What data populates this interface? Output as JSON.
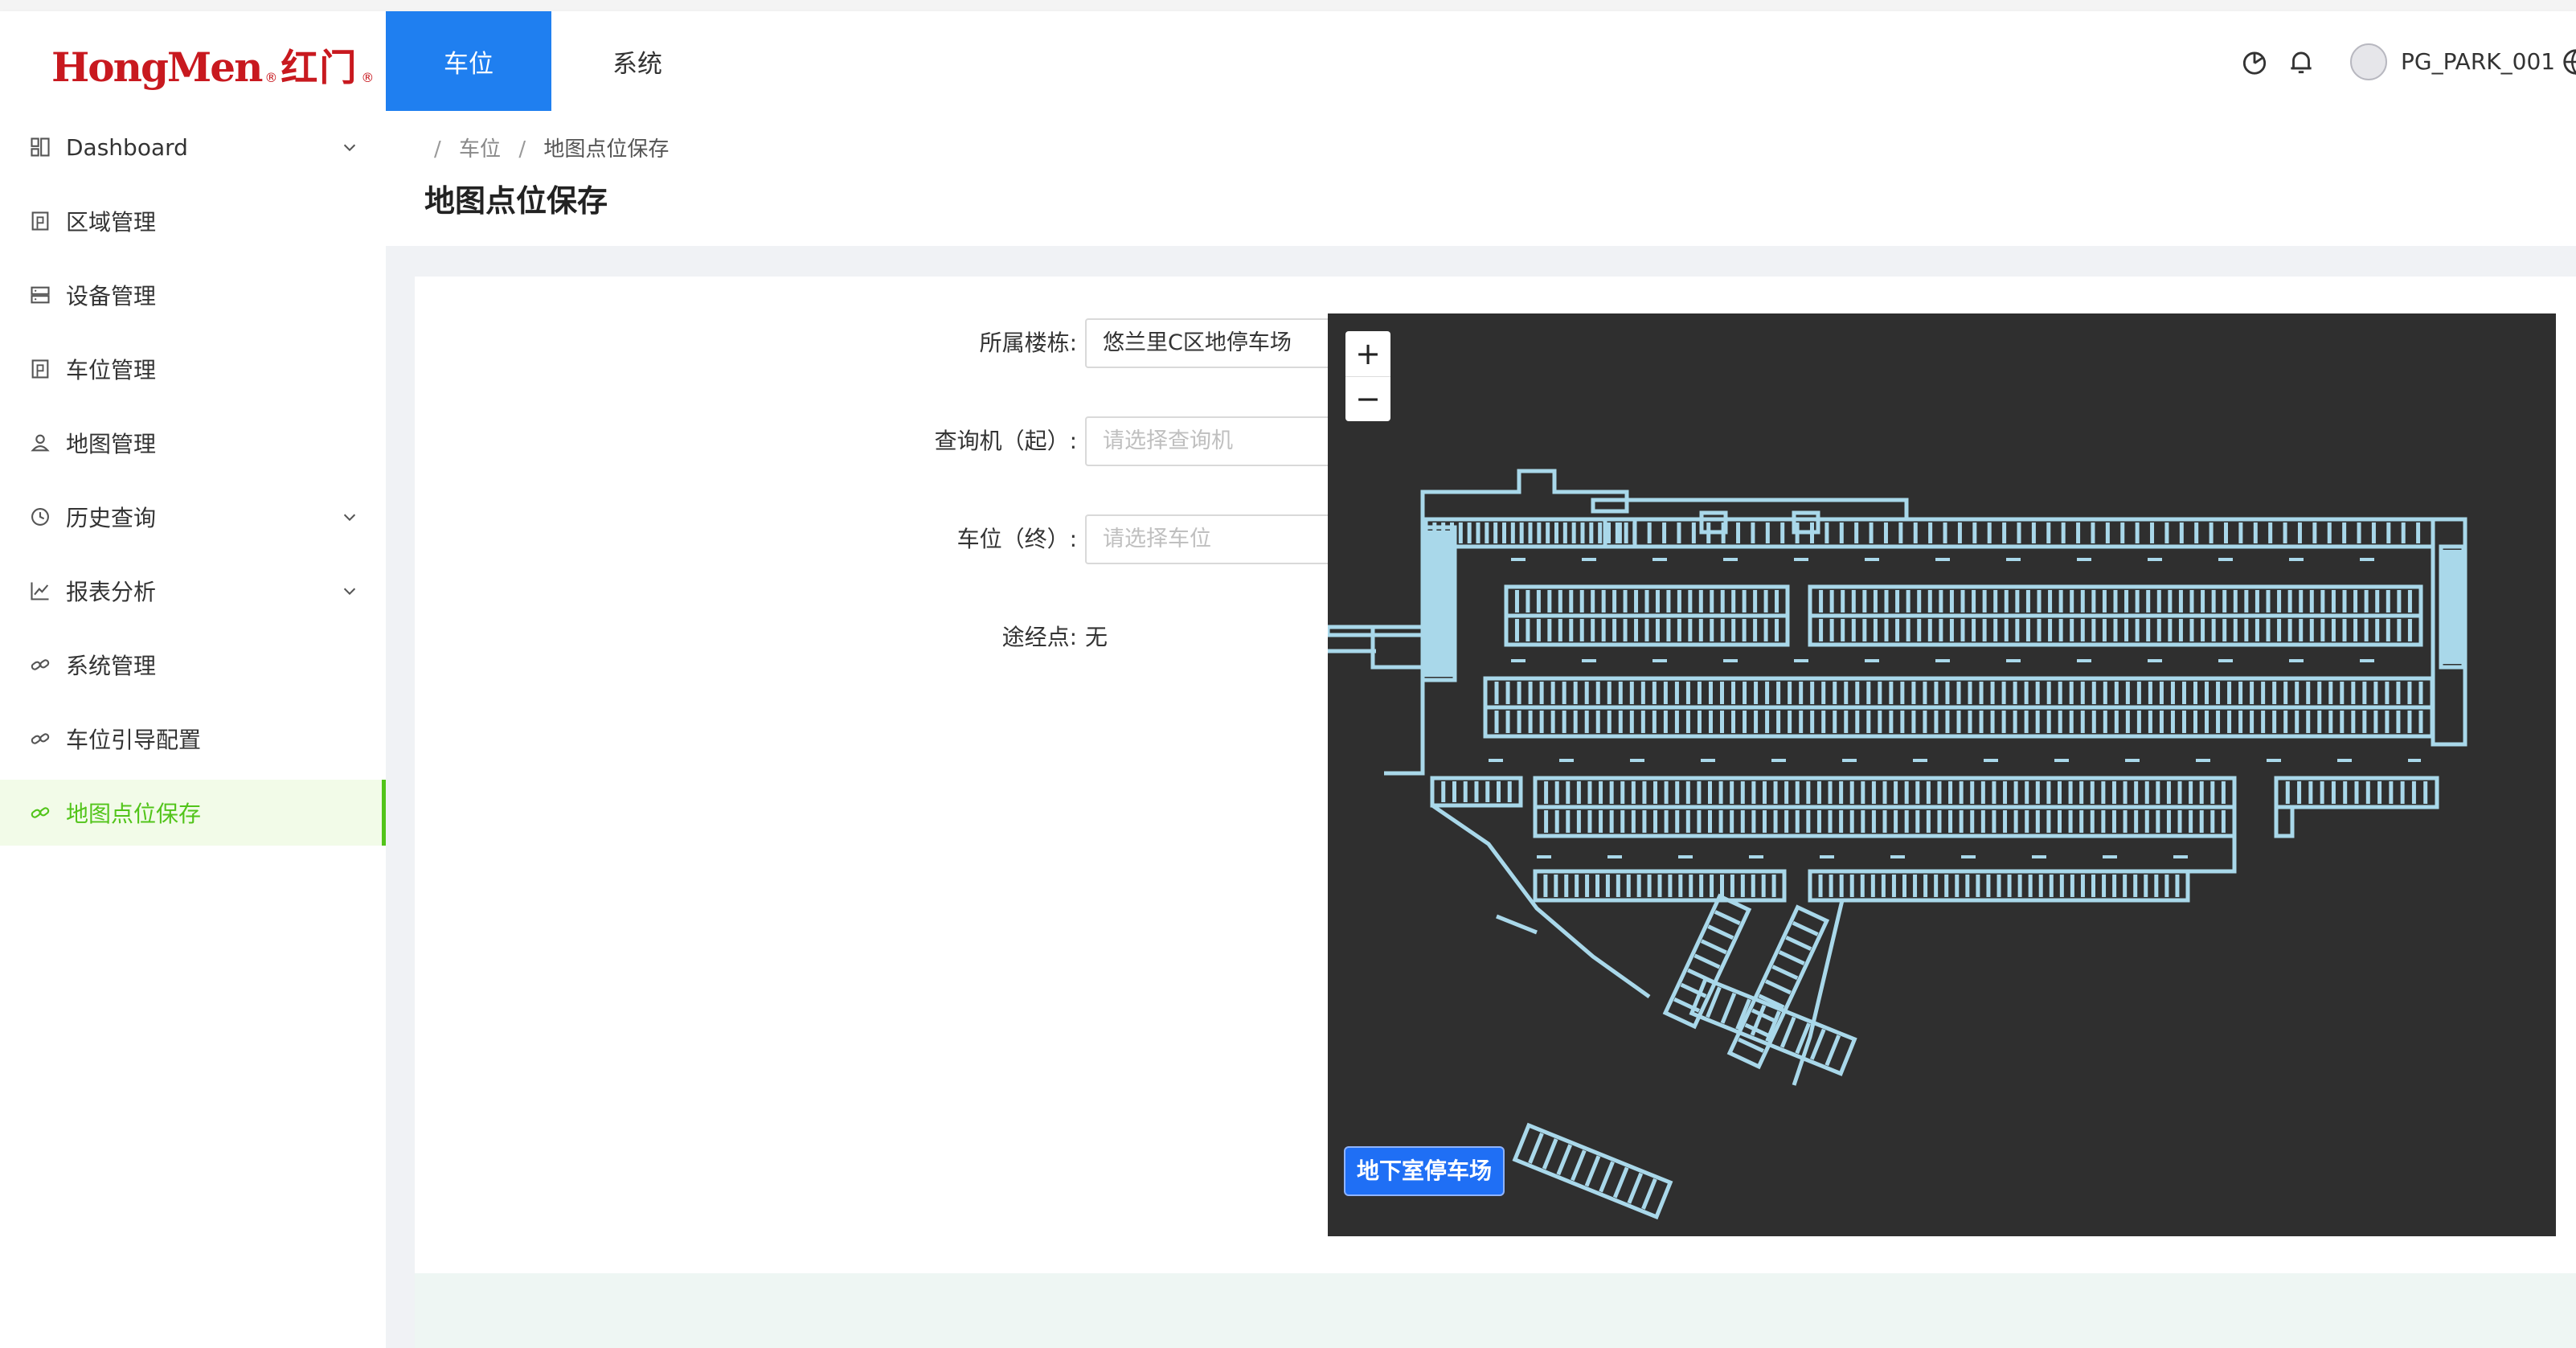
{
  "header": {
    "logo": {
      "en": "HongMen",
      "reg": "®",
      "cn": "红门"
    },
    "tabs": [
      {
        "label": "车位",
        "active": true
      },
      {
        "label": "系统",
        "active": false
      }
    ],
    "icons": [
      "dashboard-chart-icon",
      "bell-icon",
      "globe-icon"
    ],
    "username": "PG_PARK_001",
    "accent_color": "#1f7ff0"
  },
  "sidebar": {
    "items": [
      {
        "label": "Dashboard",
        "icon": "dashboard-icon",
        "has_arrow": true
      },
      {
        "label": "区域管理",
        "icon": "area-icon",
        "has_arrow": false
      },
      {
        "label": "设备管理",
        "icon": "server-icon",
        "has_arrow": false
      },
      {
        "label": "车位管理",
        "icon": "parking-space-icon",
        "has_arrow": false
      },
      {
        "label": "地图管理",
        "icon": "user-map-icon",
        "has_arrow": false
      },
      {
        "label": "历史查询",
        "icon": "history-icon",
        "has_arrow": true
      },
      {
        "label": "报表分析",
        "icon": "line-chart-icon",
        "has_arrow": true
      },
      {
        "label": "系统管理",
        "icon": "link-icon",
        "has_arrow": false
      },
      {
        "label": "车位引导配置",
        "icon": "link-icon",
        "has_arrow": false
      },
      {
        "label": "地图点位保存",
        "icon": "link-icon",
        "has_arrow": false,
        "active": true
      }
    ],
    "active_color": "#52c41a"
  },
  "breadcrumb": {
    "level1": "车位",
    "level2": "地图点位保存"
  },
  "page_title": "地图点位保存",
  "form": {
    "building": {
      "label": "所属楼栋:",
      "value": "悠兰里C区地停车场"
    },
    "kiosk": {
      "label": "查询机（起）:",
      "placeholder": "请选择查询机"
    },
    "space": {
      "label": "车位（终）:",
      "placeholder": "请选择车位"
    },
    "waypoint": {
      "label": "途经点:",
      "value": "无"
    }
  },
  "map": {
    "zoom_in": "+",
    "zoom_out": "−",
    "floor_button": "地下室停车场",
    "background_color": "#2f2f2f",
    "line_color": "#a9d8ea"
  }
}
